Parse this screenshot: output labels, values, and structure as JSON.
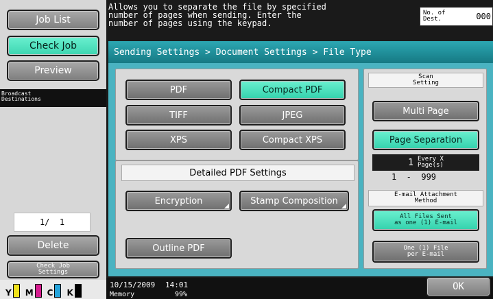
{
  "left": {
    "job_list": "Job List",
    "check_job": "Check Job",
    "preview": "Preview",
    "broadcast": "Broadcast\nDestinations",
    "counter": "1/  1",
    "delete": "Delete",
    "check_job_settings": "Check Job\nSettings",
    "ink": [
      "Y",
      "M",
      "C",
      "K"
    ],
    "ink_colors": [
      "#f0e21b",
      "#d61b8f",
      "#25a4db",
      "#000000"
    ]
  },
  "header": {
    "message": "Allows you to separate the file by specified\nnumber of pages when sending. Enter the\nnumber of pages using the keypad.",
    "dest_label": "No. of\nDest.",
    "dest_count": "000"
  },
  "breadcrumb": "Sending Settings > Document Settings > File Type",
  "file_type": {
    "pdf": "PDF",
    "compact_pdf": "Compact PDF",
    "tiff": "TIFF",
    "jpeg": "JPEG",
    "xps": "XPS",
    "compact_xps": "Compact XPS"
  },
  "detailed": {
    "title": "Detailed PDF Settings",
    "encryption": "Encryption",
    "stamp": "Stamp Composition",
    "outline": "Outline PDF"
  },
  "scan": {
    "title": "Scan\nSetting",
    "multi_page": "Multi Page",
    "page_separation": "Page Separation",
    "every_value": "1",
    "every_label": "Every X\nPage(s)",
    "range": "1  -  999",
    "email_title": "E-mail Attachment\nMethod",
    "all_files": "All Files Sent\nas one (1) E-mail",
    "one_file": "One (1) File\nper E-mail"
  },
  "footer": {
    "date": "10/15/2009",
    "time": "14:01",
    "memory_label": "Memory",
    "memory_value": "99%",
    "ok": "OK"
  }
}
